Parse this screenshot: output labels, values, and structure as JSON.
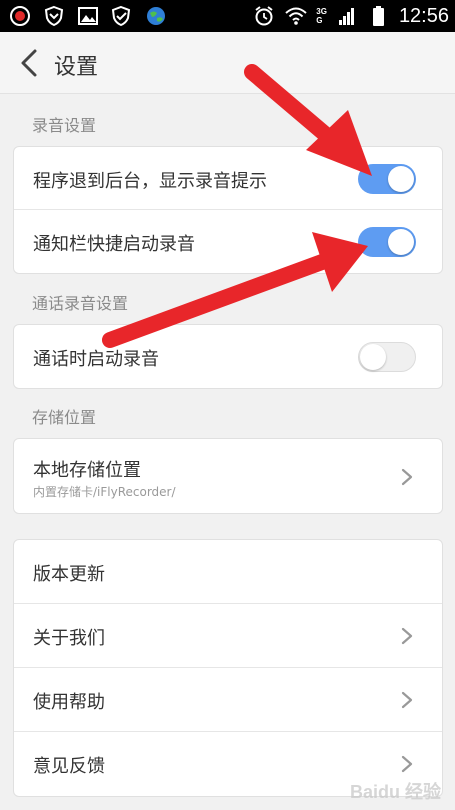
{
  "status_bar": {
    "time": "12:56",
    "network_top": "3G",
    "network_bottom": "G",
    "icons": [
      "record-icon",
      "shield-icon",
      "image-icon",
      "shield-check-icon",
      "globe-icon",
      "alarm-icon",
      "wifi-icon",
      "signal-icon",
      "battery-icon"
    ]
  },
  "header": {
    "title": "设置",
    "back_icon": "chevron-left-icon"
  },
  "sections": {
    "recording": {
      "label": "录音设置",
      "rows": [
        {
          "label": "程序退到后台，显示录音提示",
          "toggle": true
        },
        {
          "label": "通知栏快捷启动录音",
          "toggle": true
        }
      ]
    },
    "call_recording": {
      "label": "通话录音设置",
      "rows": [
        {
          "label": "通话时启动录音",
          "toggle": false
        }
      ]
    },
    "storage": {
      "label": "存储位置",
      "rows": [
        {
          "label": "本地存储位置",
          "sublabel": "内置存储卡/iFlyRecorder/"
        }
      ]
    },
    "about": {
      "rows": [
        {
          "label": "版本更新"
        },
        {
          "label": "关于我们"
        },
        {
          "label": "使用帮助"
        },
        {
          "label": "意见反馈"
        }
      ]
    }
  },
  "colors": {
    "toggle_on": "#5e9cf2",
    "annotation_arrow": "#e8262a"
  },
  "watermark": "Baidu 经验"
}
